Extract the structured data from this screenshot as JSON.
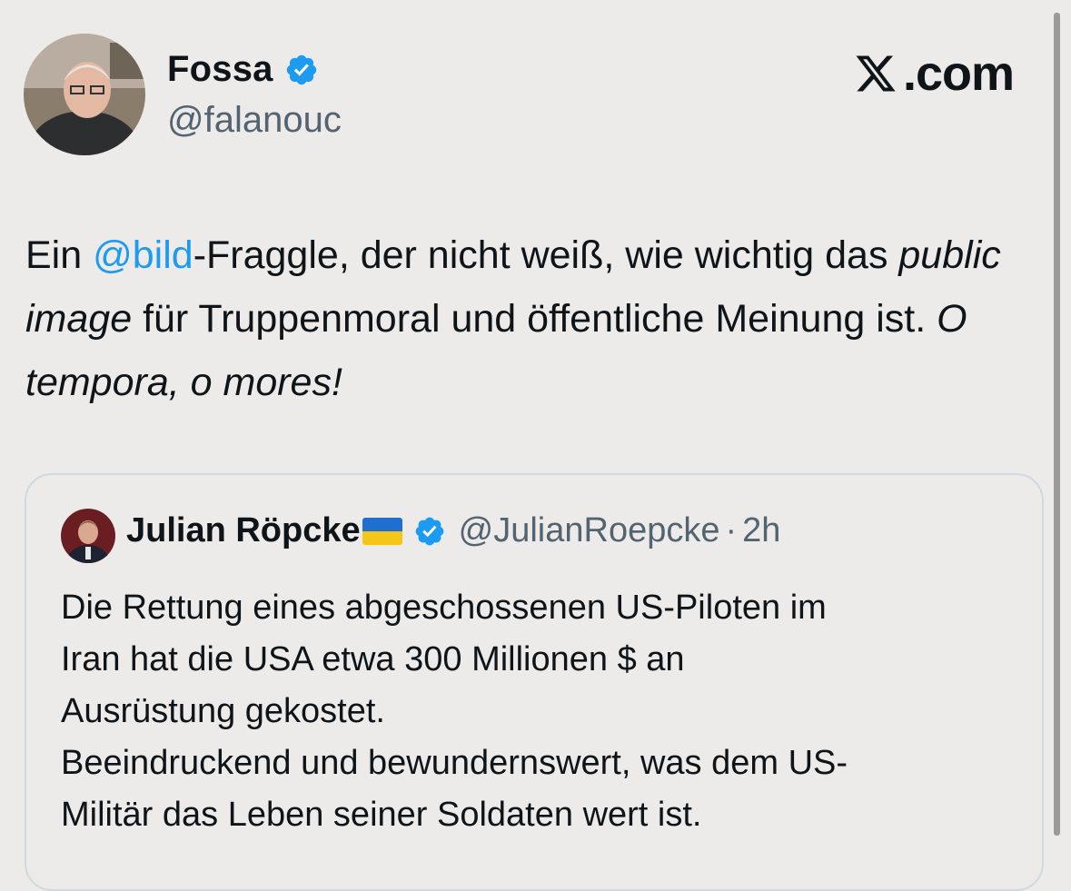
{
  "author": {
    "name": "Fossa",
    "handle": "@falanouc",
    "verified_icon": "verified-badge-icon"
  },
  "site_label": ".com",
  "colors": {
    "background": "#ecebe9",
    "accent": "#1d9bf0",
    "secondary_text": "#536471",
    "quote_border": "#cfd9de"
  },
  "tweet": {
    "part1": "Ein ",
    "mention": "@bild",
    "part2": "-Fraggle, der nicht weiß, wie wichtig das ",
    "italic1": "public image",
    "part3": " für Truppenmoral und öffentliche Meinung ist. ",
    "italic2": "O tempora, o mores!"
  },
  "quoted": {
    "name": "Julian Röpcke",
    "flag_icon": "ukraine-flag-icon",
    "handle": "@JulianRoepcke",
    "separator": "·",
    "time": "2h",
    "lines": [
      "Die Rettung eines abgeschossenen US-Piloten im",
      "Iran hat die USA etwa 300 Millionen $ an",
      "Ausrüstung gekostet.",
      "Beeindruckend und bewundernswert, was dem US-",
      "Militär das Leben seiner Soldaten wert ist."
    ]
  }
}
